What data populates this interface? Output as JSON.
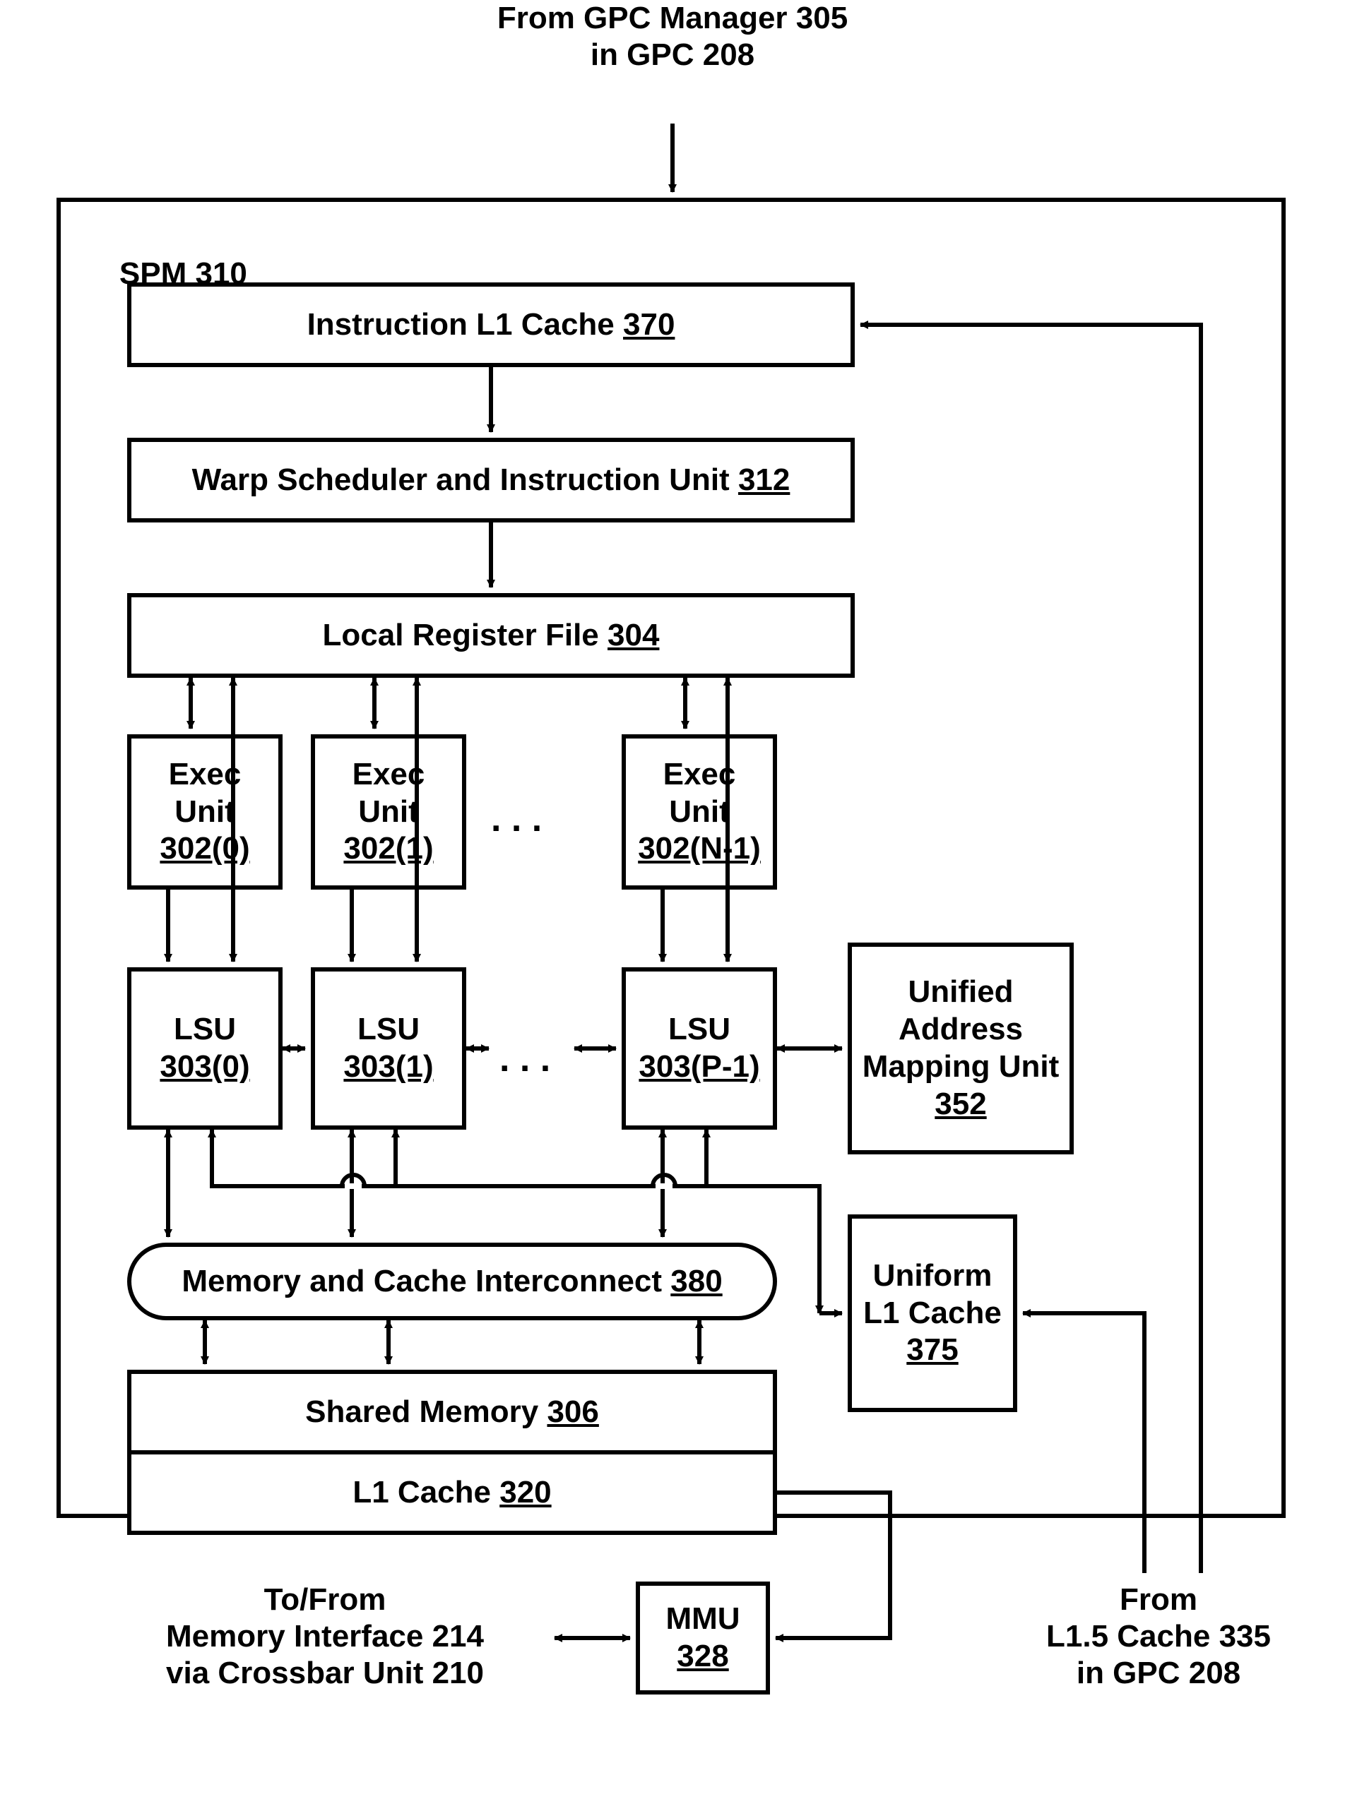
{
  "top_label": "From GPC Manager 305\nin GPC 208",
  "spm": {
    "label": "SPM ",
    "num": "310"
  },
  "instr_cache": {
    "label": "Instruction L1 Cache ",
    "num": "370"
  },
  "warp": {
    "label": "Warp Scheduler and Instruction Unit ",
    "num": "312"
  },
  "regfile": {
    "label": "Local Register File ",
    "num": "304"
  },
  "exec": [
    {
      "label": "Exec\nUnit",
      "num": "302(0)"
    },
    {
      "label": "Exec\nUnit",
      "num": "302(1)"
    },
    {
      "label": "Exec\nUnit",
      "num": "302(N-1)"
    }
  ],
  "lsu": [
    {
      "label": "LSU",
      "num": "303(0)"
    },
    {
      "label": "LSU",
      "num": "303(1)"
    },
    {
      "label": "LSU",
      "num": "303(P-1)"
    }
  ],
  "uamu": {
    "label": "Unified\nAddress\nMapping Unit",
    "num": "352"
  },
  "interconnect": {
    "label": "Memory and Cache Interconnect ",
    "num": "380"
  },
  "uniform_l1": {
    "label": "Uniform\nL1\nCache",
    "num": "375"
  },
  "shared_mem": {
    "label": "Shared Memory ",
    "num": "306"
  },
  "l1_cache": {
    "label": "L1 Cache ",
    "num": "320"
  },
  "mmu": {
    "label": "MMU",
    "num": "328"
  },
  "bottom_left": "To/From\nMemory Interface 214\nvia Crossbar Unit 210",
  "bottom_right": "From\nL1.5 Cache 335\nin GPC 208",
  "ellipsis": ". . ."
}
